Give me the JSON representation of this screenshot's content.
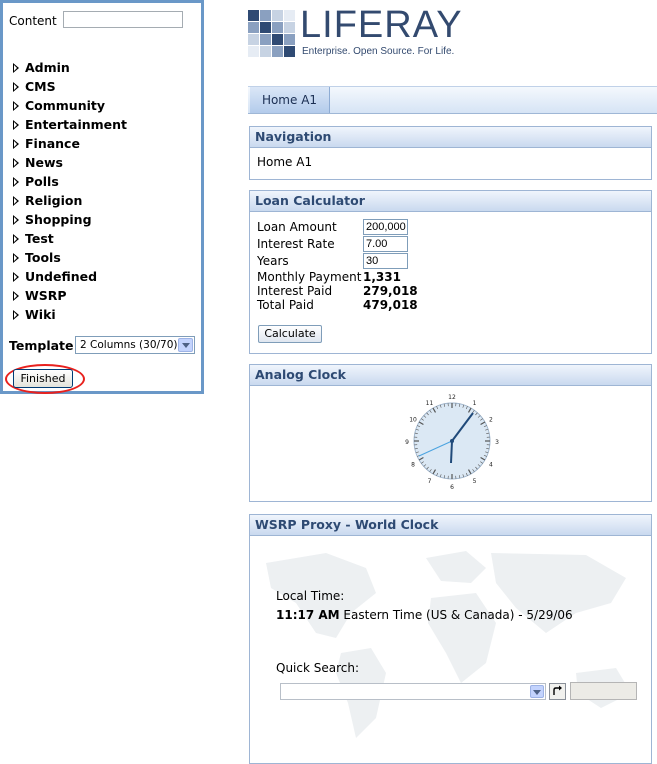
{
  "left_panel": {
    "content_label": "Content",
    "content_search": {
      "value": "",
      "placeholder": ""
    },
    "categories": [
      "Admin",
      "CMS",
      "Community",
      "Entertainment",
      "Finance",
      "News",
      "Polls",
      "Religion",
      "Shopping",
      "Test",
      "Tools",
      "Undefined",
      "WSRP",
      "Wiki"
    ],
    "template_label": "Template",
    "template_value": "2 Columns (30/70)",
    "finished_label": "Finished"
  },
  "logo": {
    "name": "LIFERAY",
    "tagline": "Enterprise. Open Source. For Life."
  },
  "tabs": [
    {
      "label": "Home A1"
    }
  ],
  "navigation": {
    "title": "Navigation",
    "item": "Home A1"
  },
  "loan": {
    "title": "Loan Calculator",
    "amount_label": "Loan Amount",
    "amount_value": "200,000",
    "rate_label": "Interest Rate",
    "rate_value": "7.00",
    "years_label": "Years",
    "years_value": "30",
    "monthly_label": "Monthly Payment",
    "monthly_value": "1,331",
    "interest_label": "Interest Paid",
    "interest_value": "279,018",
    "total_label": "Total Paid",
    "total_value": "479,018",
    "calc_label": "Calculate"
  },
  "clock": {
    "title": "Analog Clock",
    "numbers": [
      "12",
      "1",
      "2",
      "3",
      "4",
      "5",
      "6",
      "7",
      "8",
      "9",
      "10",
      "11"
    ]
  },
  "wsrp": {
    "title": "WSRP Proxy - World Clock",
    "local_label": "Local Time:",
    "time": "11:17 AM",
    "zone": " Eastern Time (US & Canada) - 5/29/06",
    "qs_label": "Quick Search:"
  },
  "colors": {
    "panel_border": "#6a98c8",
    "highlight_circle": "#e8211d",
    "portlet_title": "#2e4a73",
    "logo": "#334a6f"
  },
  "icons": [
    "triangle-right-icon",
    "dropdown-arrow-icon",
    "go-arrow-icon"
  ]
}
